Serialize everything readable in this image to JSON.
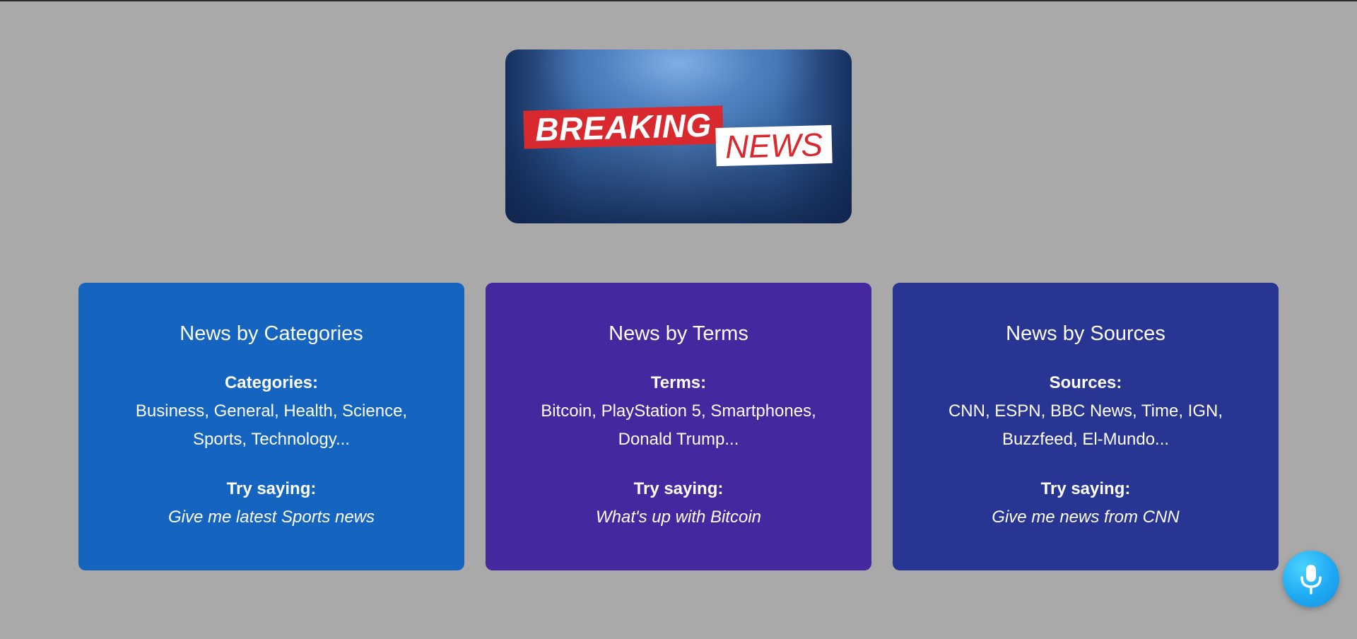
{
  "logo": {
    "breaking": "BREAKING",
    "news": "NEWS"
  },
  "cards": [
    {
      "title": "News by Categories",
      "label": "Categories:",
      "list": "Business, General, Health, Science, Sports, Technology...",
      "try_label": "Try saying:",
      "try_text": "Give me latest Sports news",
      "color": "#1565c0"
    },
    {
      "title": "News by Terms",
      "label": "Terms:",
      "list": "Bitcoin, PlayStation 5, Smartphones, Donald Trump...",
      "try_label": "Try saying:",
      "try_text": "What's up with Bitcoin",
      "color": "#4527a0"
    },
    {
      "title": "News by Sources",
      "label": "Sources:",
      "list": "CNN, ESPN, BBC News, Time, IGN, Buzzfeed, El-Mundo...",
      "try_label": "Try saying:",
      "try_text": "Give me news from CNN",
      "color": "#283593"
    }
  ],
  "mic_button": {
    "icon": "microphone-icon",
    "color": "#1fa9f3"
  },
  "colors": {
    "background": "#a9a9a9",
    "logo_red": "#d8292f"
  }
}
